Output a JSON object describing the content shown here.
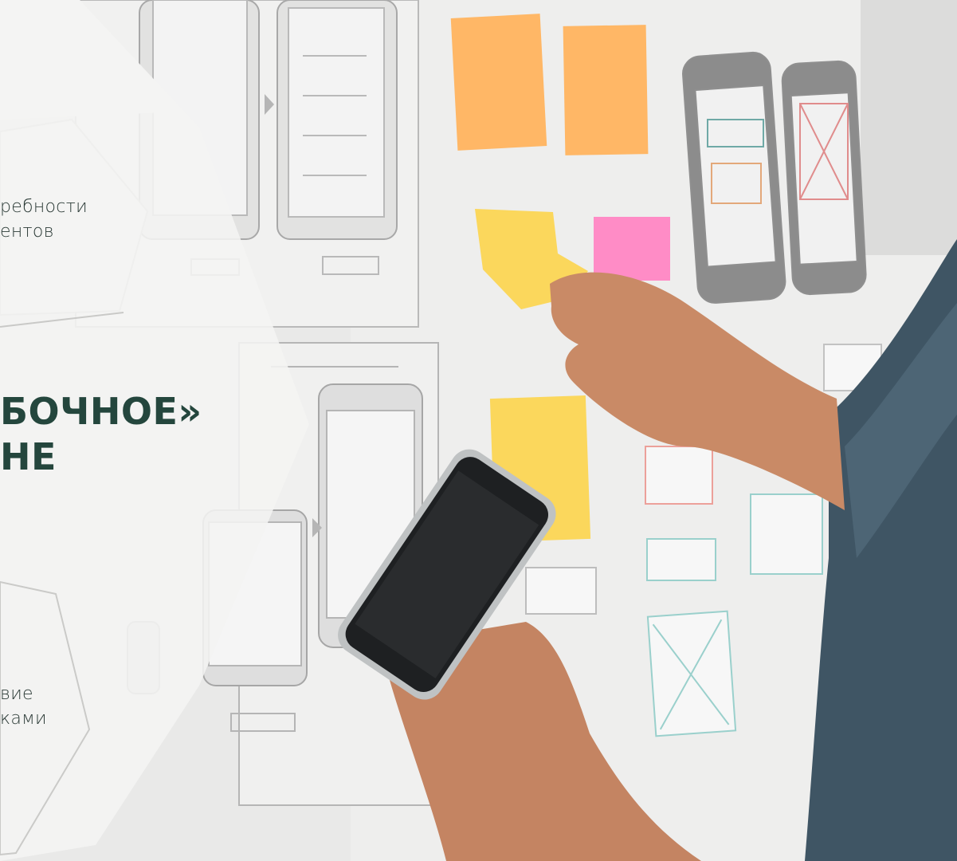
{
  "panels": {
    "needs": {
      "lines": [
        "ребности",
        "ентов"
      ]
    },
    "headline": {
      "lines": [
        "БОЧНОЕ»",
        "НЕ"
      ]
    },
    "teamwork": {
      "lines": [
        "вие",
        "ками"
      ]
    }
  },
  "colors": {
    "panel_fill": "#f4f4f3",
    "panel_line": "#c9c9c7",
    "headline": "#24463d",
    "body_text": "#2c3b37",
    "sticky_orange": "#ffb766",
    "sticky_yellow": "#fbd75c",
    "sticky_pink": "#ff8cc6",
    "wall": "#ebebea"
  }
}
